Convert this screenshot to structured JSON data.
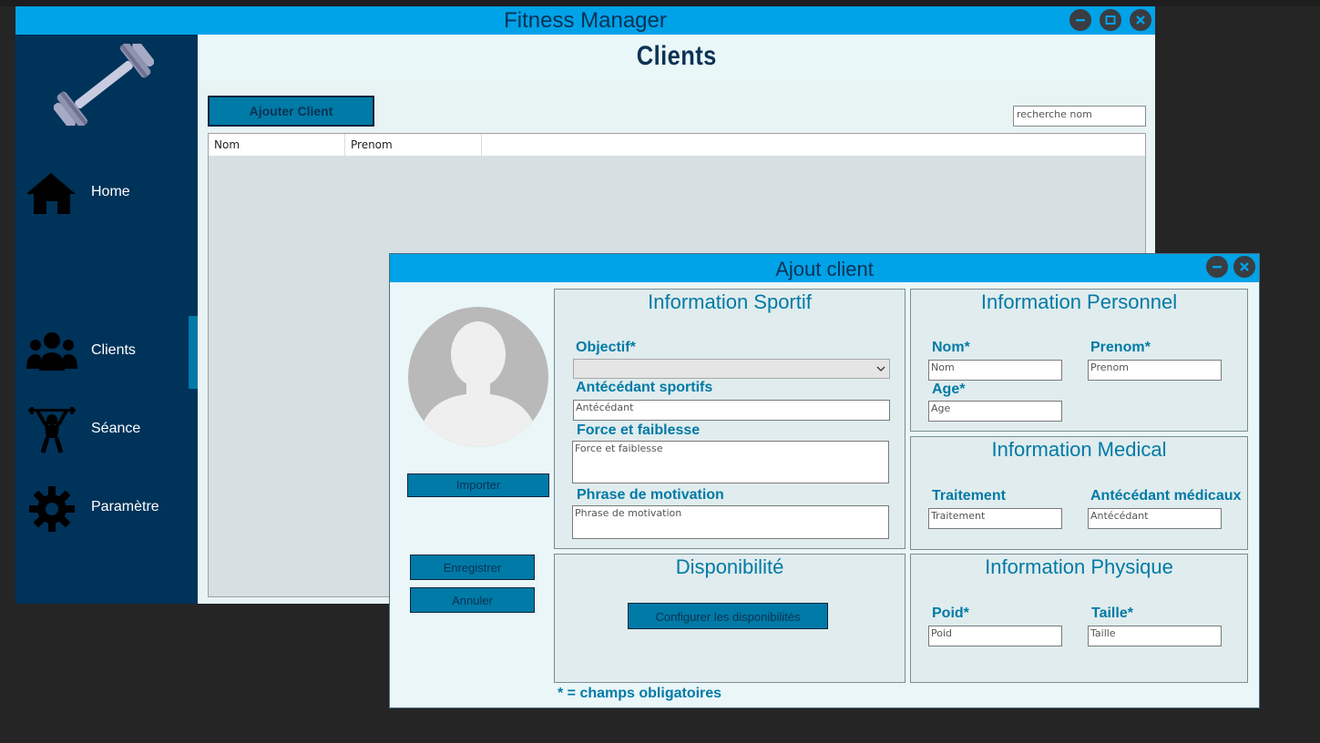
{
  "app": {
    "title": "Fitness Manager"
  },
  "sidebar": {
    "items": [
      {
        "label": "Home",
        "icon": "home-icon"
      },
      {
        "label": "Clients",
        "icon": "users-icon"
      },
      {
        "label": "Séance",
        "icon": "weightlifter-icon"
      },
      {
        "label": "Paramètre",
        "icon": "gear-icon"
      }
    ],
    "active": "Clients"
  },
  "page": {
    "title": "Clients",
    "add_button": "Ajouter Client",
    "search_placeholder": "recherche nom",
    "table_headers": [
      "Nom",
      "Prenom"
    ]
  },
  "dialog": {
    "title": "Ajout client",
    "import_button": "Importer",
    "save_button": "Enregistrer",
    "cancel_button": "Annuler",
    "required_note": "* = champs obligatoires",
    "sport": {
      "heading": "Information Sportif",
      "objectif_label": "Objectif*",
      "antecedant_label": "Antécédant sportifs",
      "antecedant_placeholder": "Antécédant",
      "force_label": "Force et faiblesse",
      "force_placeholder": "Force et faiblesse",
      "motivation_label": "Phrase de motivation",
      "motivation_placeholder": "Phrase de motivation"
    },
    "personnel": {
      "heading": "Information Personnel",
      "nom_label": "Nom*",
      "nom_placeholder": "Nom",
      "prenom_label": "Prenom*",
      "prenom_placeholder": "Prenom",
      "age_label": "Age*",
      "age_placeholder": "Age"
    },
    "medical": {
      "heading": "Information Medical",
      "traitement_label": "Traitement",
      "traitement_placeholder": "Traitement",
      "antecedant_label": "Antécédant médicaux",
      "antecedant_placeholder": "Antécédant"
    },
    "disponibilite": {
      "heading": "Disponibilité",
      "button": "Configurer les disponibilités"
    },
    "physique": {
      "heading": "Information Physique",
      "poid_label": "Poid*",
      "poid_placeholder": "Poid",
      "taille_label": "Taille*",
      "taille_placeholder": "Taille"
    }
  },
  "colors": {
    "titlebar": "#00a2e8",
    "sidebar": "#00335a",
    "accent": "#007aa6",
    "title_text": "#0b3254"
  }
}
